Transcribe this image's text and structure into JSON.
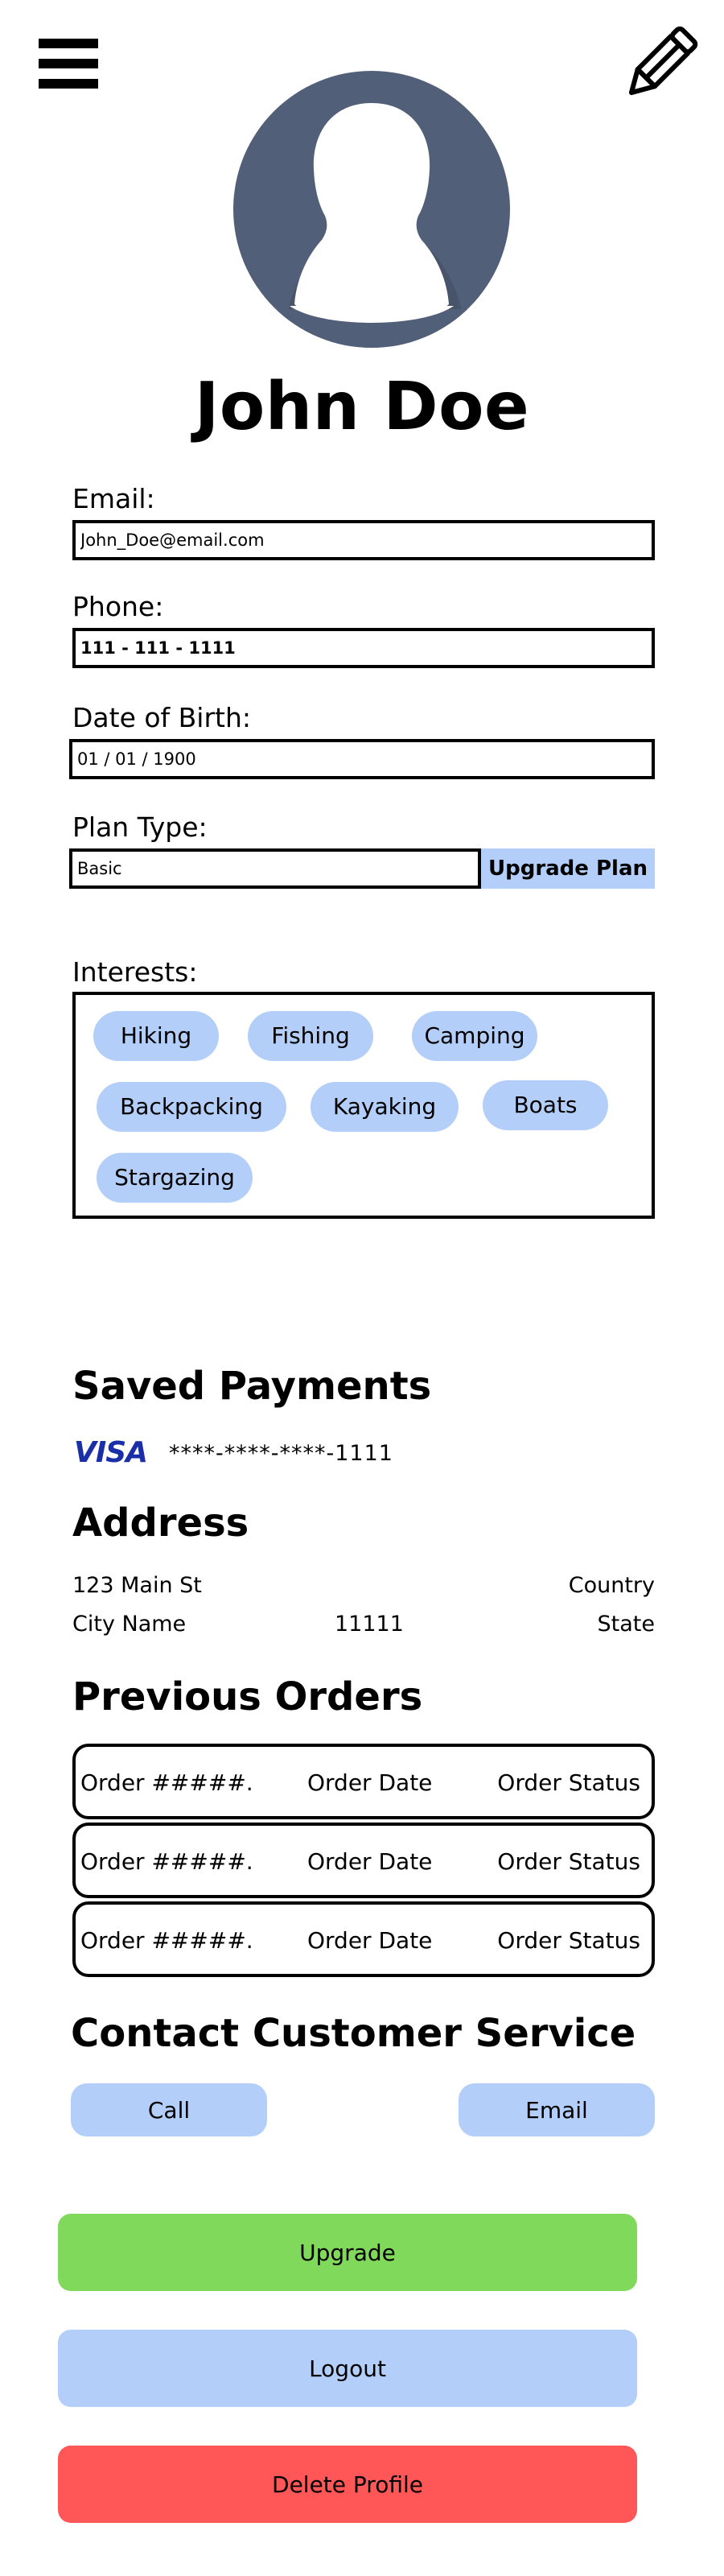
{
  "header": {
    "menu_icon": "hamburger-menu-icon",
    "edit_icon": "pencil-icon"
  },
  "profile": {
    "avatar_icon": "user-silhouette-icon",
    "name": "John Doe"
  },
  "fields": {
    "email": {
      "label": "Email:",
      "value": "John_Doe@email.com"
    },
    "phone": {
      "label": "Phone:",
      "value": "111 - 111 - 1111"
    },
    "dob": {
      "label": "Date of Birth:",
      "value": "01 / 01 / 1900"
    },
    "plan": {
      "label": "Plan Type:",
      "value": "Basic",
      "upgrade_label": "Upgrade Plan"
    }
  },
  "interests": {
    "label": "Interests:",
    "items": [
      "Hiking",
      "Fishing",
      "Camping",
      "Backpacking",
      "Kayaking",
      "Boats",
      "Stargazing"
    ]
  },
  "payments": {
    "title": "Saved Payments",
    "card_brand": "VISA",
    "card_number": "****-****-****-1111"
  },
  "address": {
    "title": "Address",
    "street": "123 Main St",
    "country": "Country",
    "city": "City Name",
    "zip": "11111",
    "state": "State"
  },
  "orders": {
    "title": "Previous Orders",
    "rows": [
      {
        "number": "Order #####.",
        "date": "Order Date",
        "status": "Order Status"
      },
      {
        "number": "Order #####.",
        "date": "Order Date",
        "status": "Order Status"
      },
      {
        "number": "Order #####.",
        "date": "Order Date",
        "status": "Order Status"
      }
    ]
  },
  "contact": {
    "title": "Contact Customer Service",
    "call_label": "Call",
    "email_label": "Email"
  },
  "actions": {
    "upgrade_label": "Upgrade",
    "logout_label": "Logout",
    "delete_label": "Delete Profile"
  },
  "colors": {
    "avatar": "#525f78",
    "chip": "#b3cef8",
    "upgrade": "#80d95a",
    "logout": "#b3cef8",
    "delete": "#ff5757",
    "visa": "#1a2ea8"
  }
}
